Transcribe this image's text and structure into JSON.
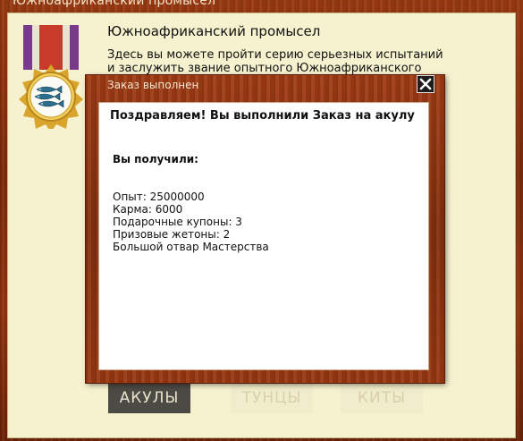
{
  "window": {
    "title": "Южноафриканский промысел",
    "heading": "Южноафриканский промысел",
    "description": "Здесь вы можете пройти серию серьезных испытаний и заслужить звание опытного Южноафриканского"
  },
  "tabs": [
    {
      "label": "АКУЛЫ",
      "active": true
    },
    {
      "label": "ТУНЦЫ",
      "active": false
    },
    {
      "label": "КИТЫ",
      "active": false
    }
  ],
  "modal": {
    "title": "Заказ выполнен",
    "heading": "Поздравляем! Вы выполнили Заказ на акулу",
    "received_label": "Вы получили:",
    "rewards": [
      "Опыт: 25000000",
      "Карма: 6000",
      "Подарочные купоны: 3",
      "Призовые жетоны: 2",
      "Большой отвар Мастерства"
    ]
  },
  "colors": {
    "wood": "#8a3210",
    "panel": "#f6f1cf",
    "active_tab": "#4c4a44",
    "ribbon_purple": "#7a3a8c",
    "ribbon_red": "#c83a2a",
    "medal_gold": "#e2b43a"
  },
  "icons": {
    "medal": "fishing-medal-icon",
    "close": "close-icon"
  }
}
